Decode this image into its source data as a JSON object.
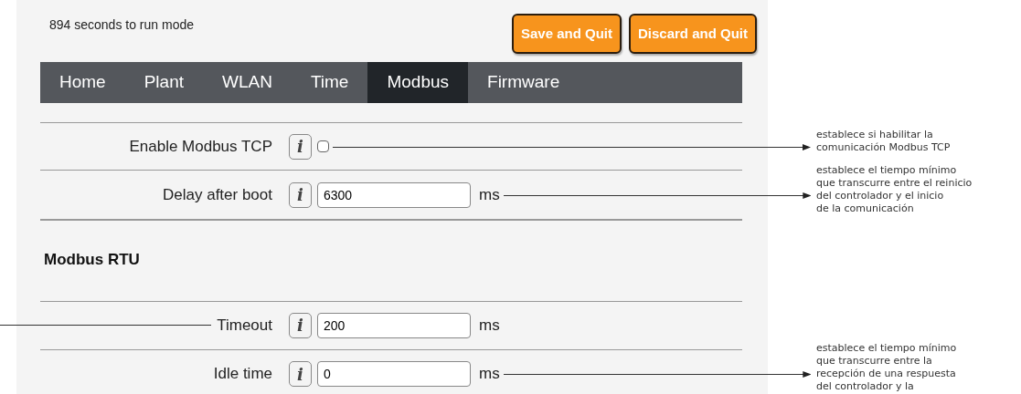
{
  "status": "894 seconds to run mode",
  "buttons": [
    {
      "label": "Save and Quit"
    },
    {
      "label": "Discard and Quit"
    }
  ],
  "tabs": [
    {
      "label": "Home",
      "selected": false
    },
    {
      "label": "Plant",
      "selected": false
    },
    {
      "label": "WLAN",
      "selected": false
    },
    {
      "label": "Time",
      "selected": false
    },
    {
      "label": "Modbus",
      "selected": true
    },
    {
      "label": "Firmware",
      "selected": false
    }
  ],
  "tcp_fields": [
    {
      "label": "Enable Modbus TCP",
      "info": "i",
      "kind": "checkbox",
      "checked": false,
      "left_leader": false,
      "annotation": "establece si habilitar la\ncomunicación Modbus TCP"
    },
    {
      "label": "Delay after boot",
      "info": "i",
      "kind": "number",
      "value": "6300",
      "unit": "ms",
      "left_leader": false,
      "annotation": "establece el tiempo mínimo\nque transcurre entre el reinicio\ndel controlador y el inicio\nde la comunicación"
    }
  ],
  "rtu_heading": "Modbus RTU",
  "rtu_fields": [
    {
      "label": "Timeout",
      "info": "i",
      "kind": "number",
      "value": "200",
      "unit": "ms",
      "left_leader": true
    },
    {
      "label": "Idle time",
      "info": "i",
      "kind": "number",
      "value": "0",
      "unit": "ms",
      "left_leader": false,
      "annotation": "establece el tiempo mínimo\nque transcurre entre la\nrecepción de una respuesta\ndel controlador y la"
    }
  ]
}
